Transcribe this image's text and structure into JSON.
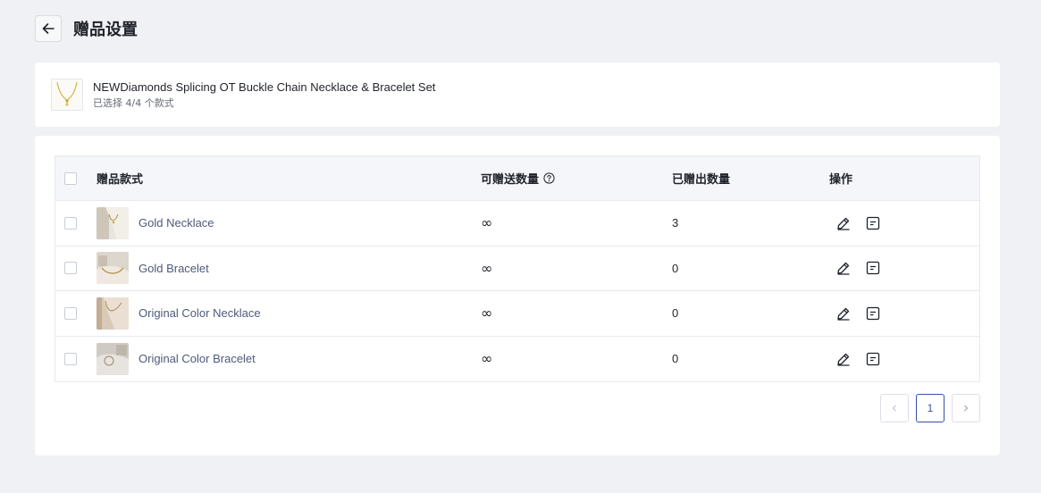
{
  "header": {
    "title": "赠品设置"
  },
  "product": {
    "name": "NEWDiamonds Splicing OT Buckle Chain Necklace & Bracelet Set",
    "selection": "已选择 4/4 个款式"
  },
  "table": {
    "columns": {
      "style": "赠品款式",
      "available": "可赠送数量",
      "sent": "已赠出数量",
      "actions": "操作"
    },
    "rows": [
      {
        "name": "Gold Necklace",
        "available": "∞",
        "sent": "3"
      },
      {
        "name": "Gold Bracelet",
        "available": "∞",
        "sent": "0"
      },
      {
        "name": "Original Color Necklace",
        "available": "∞",
        "sent": "0"
      },
      {
        "name": "Original Color Bracelet",
        "available": "∞",
        "sent": "0"
      }
    ]
  },
  "pagination": {
    "current": "1",
    "prev_icon": "chevron-left-icon",
    "next_icon": "chevron-right-icon"
  },
  "colors": {
    "background": "#f0f1f4",
    "accent": "#3a4fa8",
    "link_text": "#4e5a7a"
  }
}
